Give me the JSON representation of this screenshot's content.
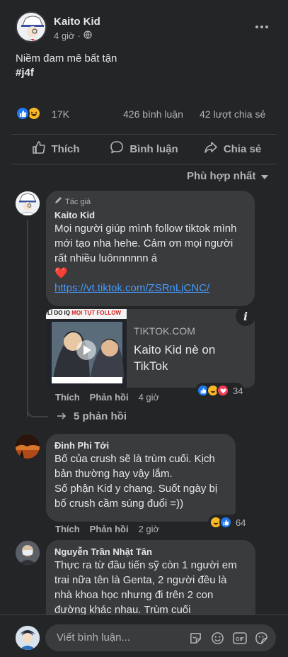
{
  "post": {
    "author": "Kaito Kid",
    "time": "4 giờ",
    "privacy_icon": "globe-icon",
    "text": "Niềm đam mê bất tận",
    "hashtag": "#j4f"
  },
  "stats": {
    "reactions": "17K",
    "comments": "426 bình luận",
    "shares": "42 lượt chia sẻ"
  },
  "actions": {
    "like": "Thích",
    "comment": "Bình luận",
    "share": "Chia sẻ"
  },
  "sort": {
    "label": "Phù hợp nhất"
  },
  "comments": [
    {
      "badge": "Tác giả",
      "author": "Kaito Kid",
      "text": "Mọi người giúp mình follow tiktok mình mới tạo nha hehe. Cảm ơn mọi người rất nhiều luônnnnnn á",
      "heart": "❤️",
      "link": "https://vt.tiktok.com/ZSRnLjCNC/",
      "card": {
        "thumb_text": "LÍ DO IQ",
        "thumb_text_red": "MỌI TỤT",
        "thumb_text2": "FOLLOW",
        "domain": "TIKTOK.COM",
        "title": "Kaito Kid nè on TikTok"
      },
      "like_label": "Thích",
      "reply_label": "Phản hồi",
      "time": "4 giờ",
      "reaction_count": "34",
      "replies_label": "5 phản hồi"
    },
    {
      "author": "Đinh Phi Tới",
      "text": "Bố của crush sẽ là trùm cuối. Kịch bản thường hay vậy lắm.",
      "text2": "Số phận Kid y chang. Suốt ngày bị bố crush cầm súng đuổi =))",
      "like_label": "Thích",
      "reply_label": "Phản hồi",
      "time": "2 giờ",
      "reaction_count": "64"
    },
    {
      "author": "Nguyễn Trần Nhật Tân",
      "text": "Thực ra từ đầu tiến sỹ còn 1 người em trai nữa tên là Genta, 2 người đều là nhà khoa học nhưng đi trên 2 con đường khác nhau. Trùm cuối"
    }
  ],
  "composer": {
    "placeholder": "Viết bình luận...",
    "icons": [
      "sticker-icon",
      "emoji-icon",
      "gif-icon",
      "sticker-face-icon"
    ]
  },
  "colors": {
    "background": "#242526",
    "bubble": "#3a3b3c",
    "link": "#4599ff",
    "like_blue": "#2078f4"
  }
}
